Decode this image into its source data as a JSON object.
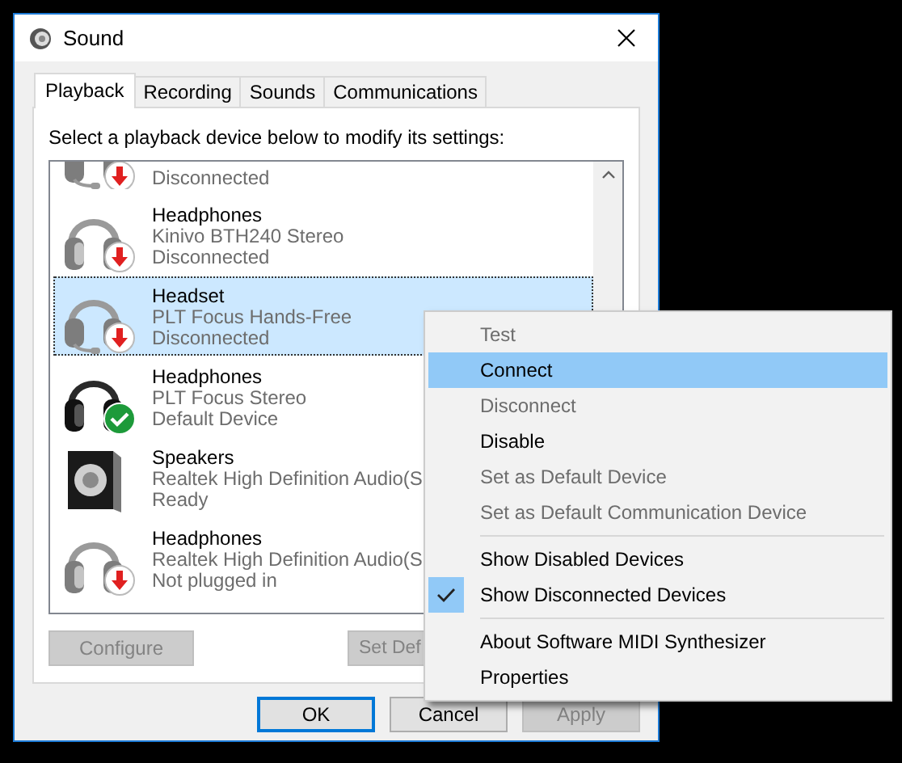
{
  "window": {
    "title": "Sound"
  },
  "tabs": [
    {
      "label": "Playback",
      "selected": true
    },
    {
      "label": "Recording",
      "selected": false
    },
    {
      "label": "Sounds",
      "selected": false
    },
    {
      "label": "Communications",
      "selected": false
    }
  ],
  "instruction": "Select a playback device below to modify its settings:",
  "devices": [
    {
      "kind": "headset",
      "disconnected": true,
      "default": false,
      "status": "Disconnected",
      "selected": false
    },
    {
      "kind": "headphones",
      "disconnected": true,
      "default": false,
      "name": "Headphones",
      "description": "Kinivo BTH240 Stereo",
      "status": "Disconnected",
      "selected": false
    },
    {
      "kind": "headset",
      "disconnected": true,
      "default": false,
      "name": "Headset",
      "description": "PLT Focus Hands-Free",
      "status": "Disconnected",
      "selected": true
    },
    {
      "kind": "headphones",
      "disconnected": false,
      "default": true,
      "name": "Headphones",
      "description": "PLT Focus Stereo",
      "status": "Default Device",
      "selected": false
    },
    {
      "kind": "speakers",
      "disconnected": false,
      "default": false,
      "name": "Speakers",
      "description": "Realtek High Definition Audio(S",
      "status": "Ready",
      "selected": false
    },
    {
      "kind": "headphones",
      "disconnected": true,
      "default": false,
      "name": "Headphones",
      "description": "Realtek High Definition Audio(S",
      "status": "Not plugged in",
      "selected": false
    }
  ],
  "panel_buttons": [
    {
      "label": "Configure",
      "disabled": true
    },
    {
      "label": "Set Def",
      "disabled": true
    }
  ],
  "dialog_buttons": [
    {
      "label": "OK",
      "disabled": false,
      "default": true
    },
    {
      "label": "Cancel",
      "disabled": false,
      "default": false
    },
    {
      "label": "Apply",
      "disabled": true,
      "default": false
    }
  ],
  "context_menu": [
    {
      "kind": "item",
      "label": "Test",
      "disabled": true,
      "selected": false,
      "checked": false
    },
    {
      "kind": "item",
      "label": "Connect",
      "disabled": false,
      "selected": true,
      "checked": false
    },
    {
      "kind": "item",
      "label": "Disconnect",
      "disabled": true,
      "selected": false,
      "checked": false
    },
    {
      "kind": "item",
      "label": "Disable",
      "disabled": false,
      "selected": false,
      "checked": false
    },
    {
      "kind": "item",
      "label": "Set as Default Device",
      "disabled": true,
      "selected": false,
      "checked": false
    },
    {
      "kind": "item",
      "label": "Set as Default Communication Device",
      "disabled": true,
      "selected": false,
      "checked": false
    },
    {
      "kind": "separator"
    },
    {
      "kind": "item",
      "label": "Show Disabled Devices",
      "disabled": false,
      "selected": false,
      "checked": false
    },
    {
      "kind": "item",
      "label": "Show Disconnected Devices",
      "disabled": false,
      "selected": false,
      "checked": true
    },
    {
      "kind": "separator"
    },
    {
      "kind": "item",
      "label": "About Software MIDI Synthesizer",
      "disabled": false,
      "selected": false,
      "checked": false
    },
    {
      "kind": "item",
      "label": "Properties",
      "disabled": false,
      "selected": false,
      "checked": false
    }
  ]
}
